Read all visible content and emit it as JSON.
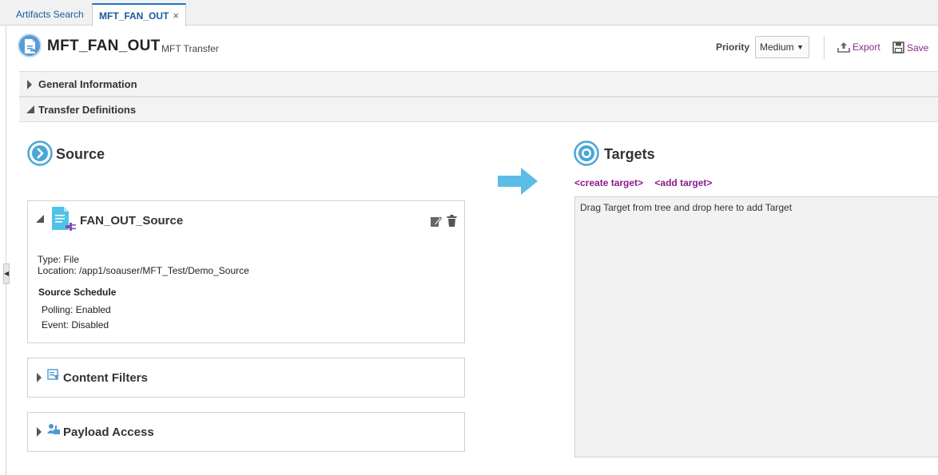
{
  "tabs": [
    {
      "label": "Artifacts Search",
      "active": false
    },
    {
      "label": "MFT_FAN_OUT",
      "active": true,
      "close": "×"
    }
  ],
  "header": {
    "title": "MFT_FAN_OUT",
    "subtitle": "MFT Transfer",
    "priority_label": "Priority",
    "priority_value": "Medium",
    "export_label": "Export",
    "save_label": "Save"
  },
  "sections": {
    "general": "General Information",
    "transfer": "Transfer Definitions"
  },
  "source": {
    "title": "Source",
    "name": "FAN_OUT_Source",
    "type": "Type: File",
    "location": "Location: /app1/soauser/MFT_Test/Demo_Source",
    "schedule_title": "Source Schedule",
    "polling": "Polling: Enabled",
    "event": "Event: Disabled",
    "content_filters": "Content Filters",
    "payload_access": "Payload Access"
  },
  "targets": {
    "title": "Targets",
    "create_link": "<create target>",
    "add_link": "<add target>",
    "drop_hint": "Drag Target from tree and drop here to add Target"
  },
  "colors": {
    "accent_blue": "#1a73c6",
    "link_purple": "#8b1a8b",
    "arrow": "#5bbce8",
    "icon_blue": "#4aa6d6"
  }
}
